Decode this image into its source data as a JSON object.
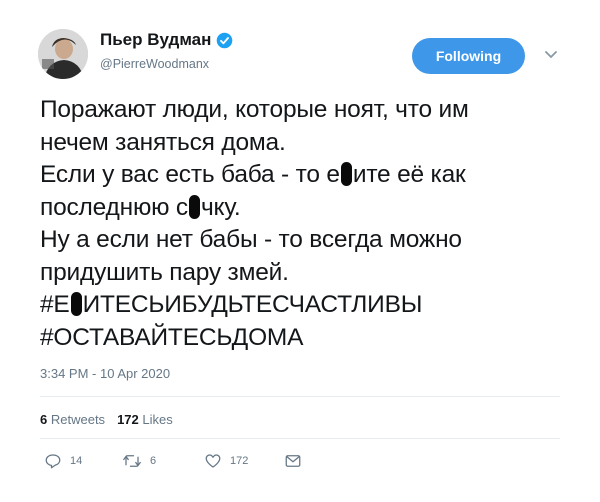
{
  "author": {
    "display_name": "Пьер Вудман",
    "handle": "@PierreWoodmanx",
    "verified": true
  },
  "follow_button": {
    "label": "Following"
  },
  "tweet": {
    "lines": [
      {
        "parts": [
          "Поражают люди, которые ноят, что им"
        ]
      },
      {
        "parts": [
          "нечем заняться дома."
        ]
      },
      {
        "parts": [
          "Если у вас есть баба - то е",
          "ите её как"
        ]
      },
      {
        "parts": [
          "последнюю с",
          "чку."
        ]
      },
      {
        "parts": [
          "Ну а если нет бабы - то всегда можно"
        ]
      },
      {
        "parts": [
          "придушить пару змей."
        ]
      },
      {
        "parts": [
          "#Е",
          "ИТЕСЬИБУДЬТЕСЧАСТЛИВЫ"
        ]
      },
      {
        "parts": [
          "#ОСТАВАЙТЕСЬДОМА"
        ]
      }
    ]
  },
  "timestamp": "3:34 PM - 10 Apr 2020",
  "stats": {
    "retweets_count": "6",
    "retweets_label": "Retweets",
    "likes_count": "172",
    "likes_label": "Likes"
  },
  "actions": {
    "reply_count": "14",
    "retweet_count": "6",
    "like_count": "172"
  },
  "colors": {
    "accent": "#3e97e8",
    "secondary_text": "#657786",
    "verified_badge": "#1da1f2"
  }
}
